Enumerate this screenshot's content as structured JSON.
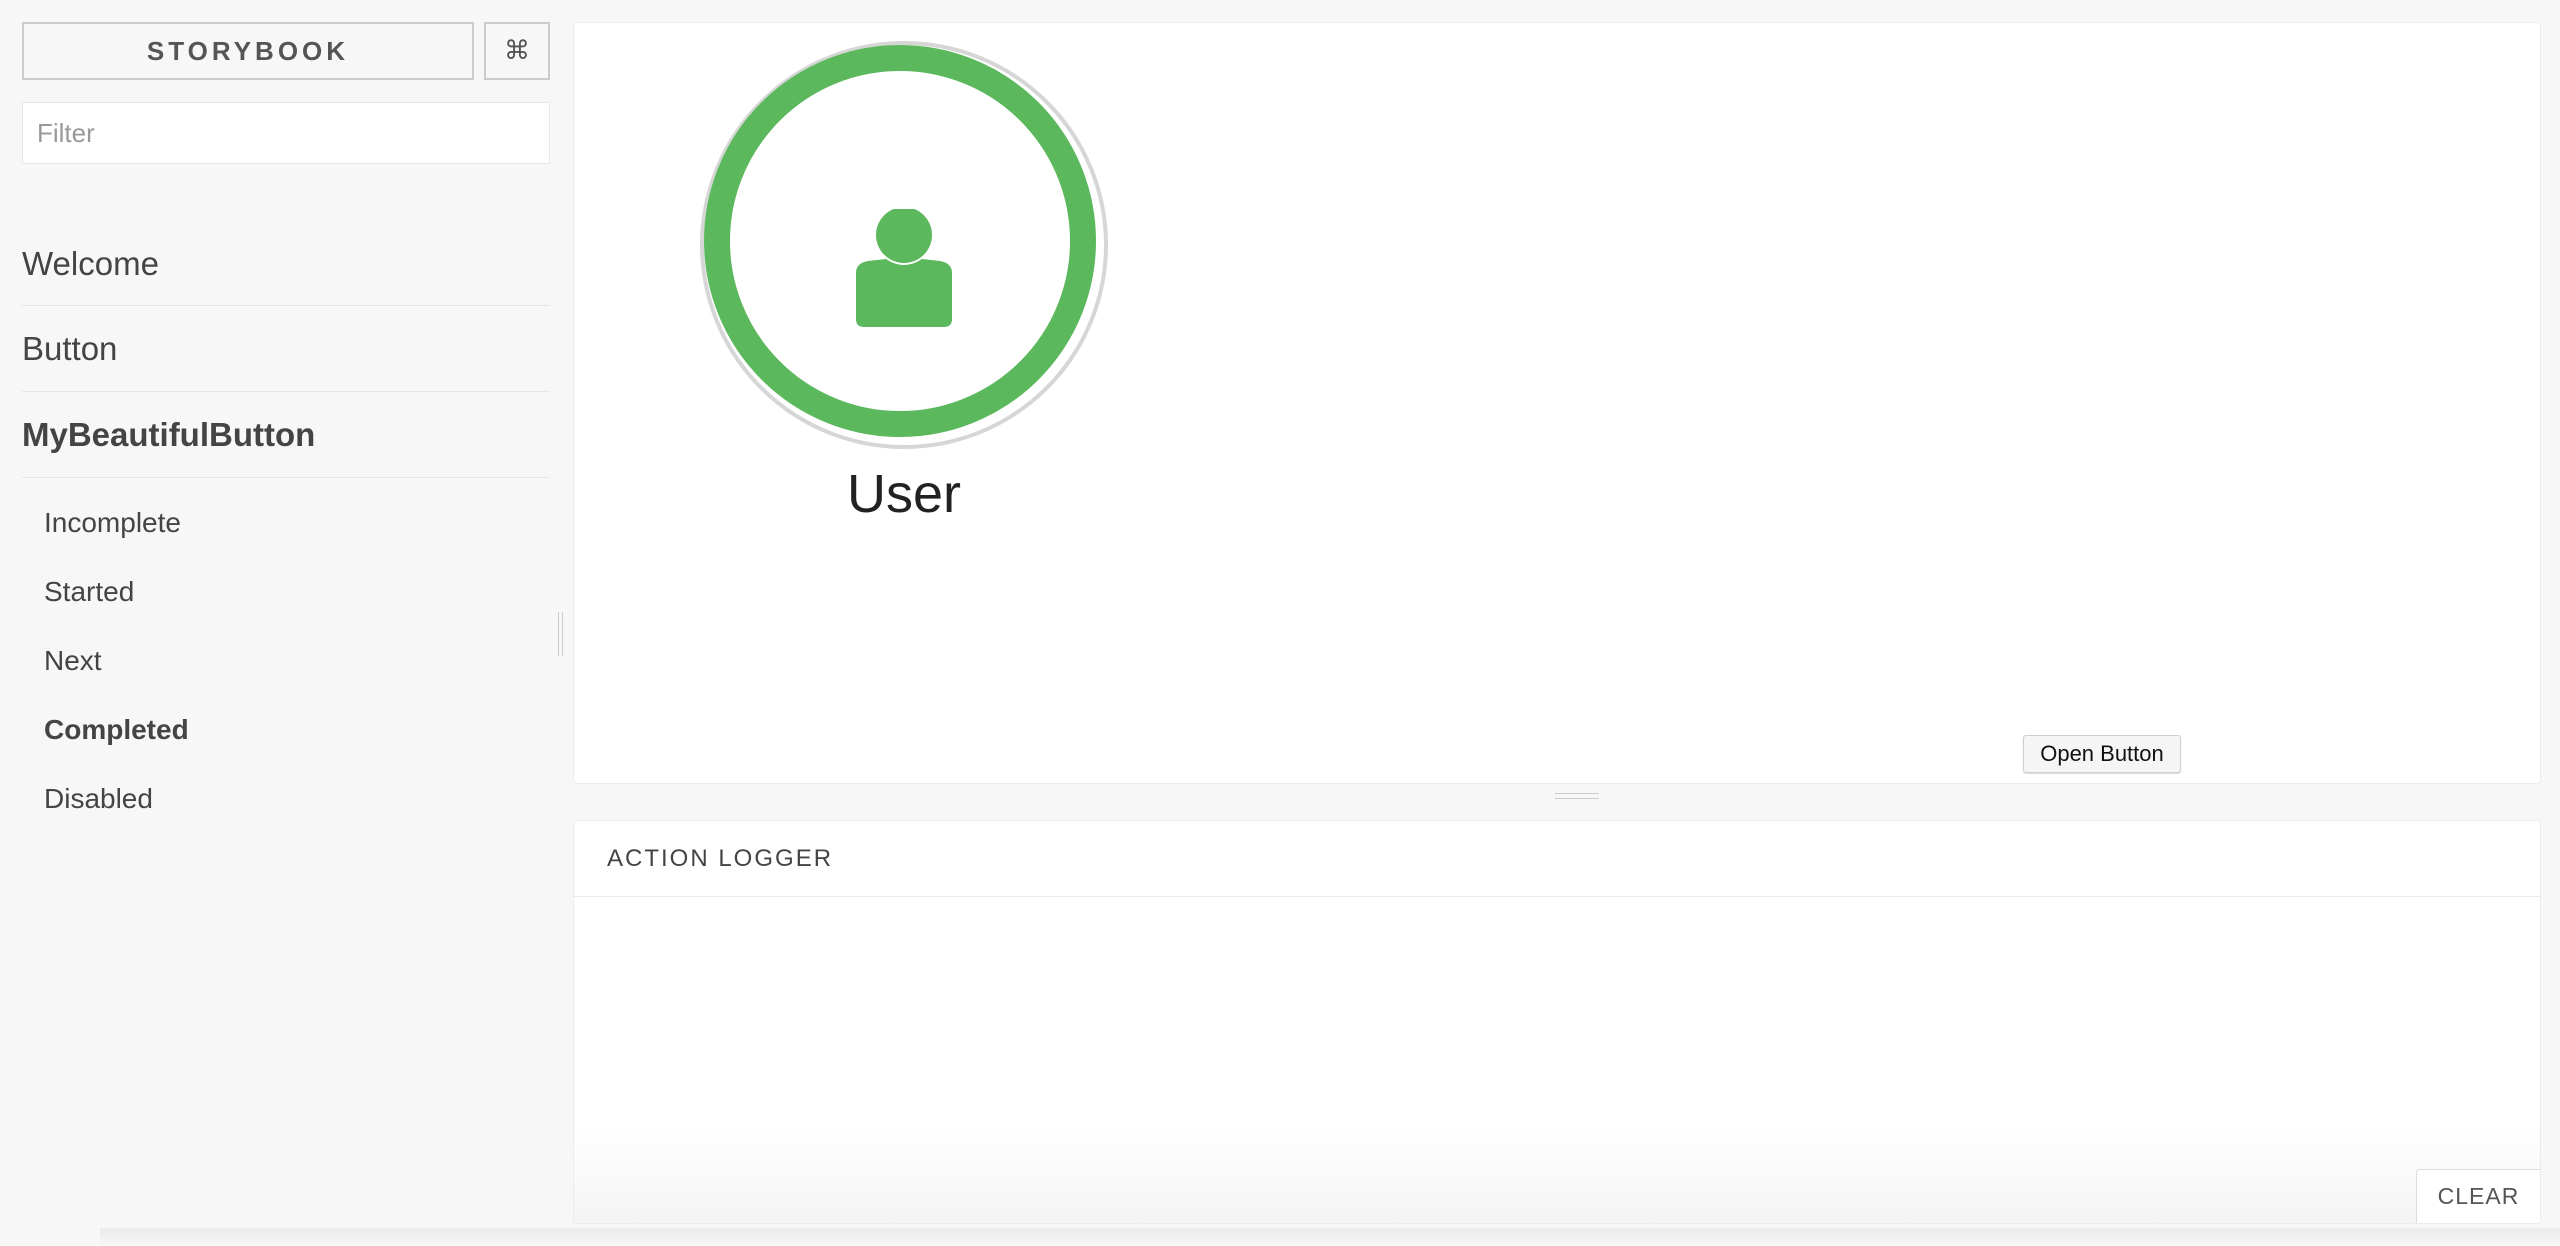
{
  "header": {
    "brand_label": "STORYBOOK",
    "shortcuts_label": "⌘"
  },
  "filter": {
    "placeholder": "Filter",
    "value": ""
  },
  "nav": {
    "kinds": [
      {
        "label": "Welcome"
      },
      {
        "label": "Button"
      },
      {
        "label": "MyBeautifulButton",
        "active": true
      }
    ],
    "stories": [
      {
        "label": "Incomplete"
      },
      {
        "label": "Started"
      },
      {
        "label": "Next"
      },
      {
        "label": "Completed",
        "selected": true
      },
      {
        "label": "Disabled"
      }
    ]
  },
  "preview": {
    "avatar": {
      "icon": "user-icon",
      "label": "User",
      "ring_color": "#5cb85c"
    },
    "open_button_label": "Open Button"
  },
  "addon_panel": {
    "tab_label": "ACTION LOGGER",
    "clear_label": "CLEAR"
  }
}
